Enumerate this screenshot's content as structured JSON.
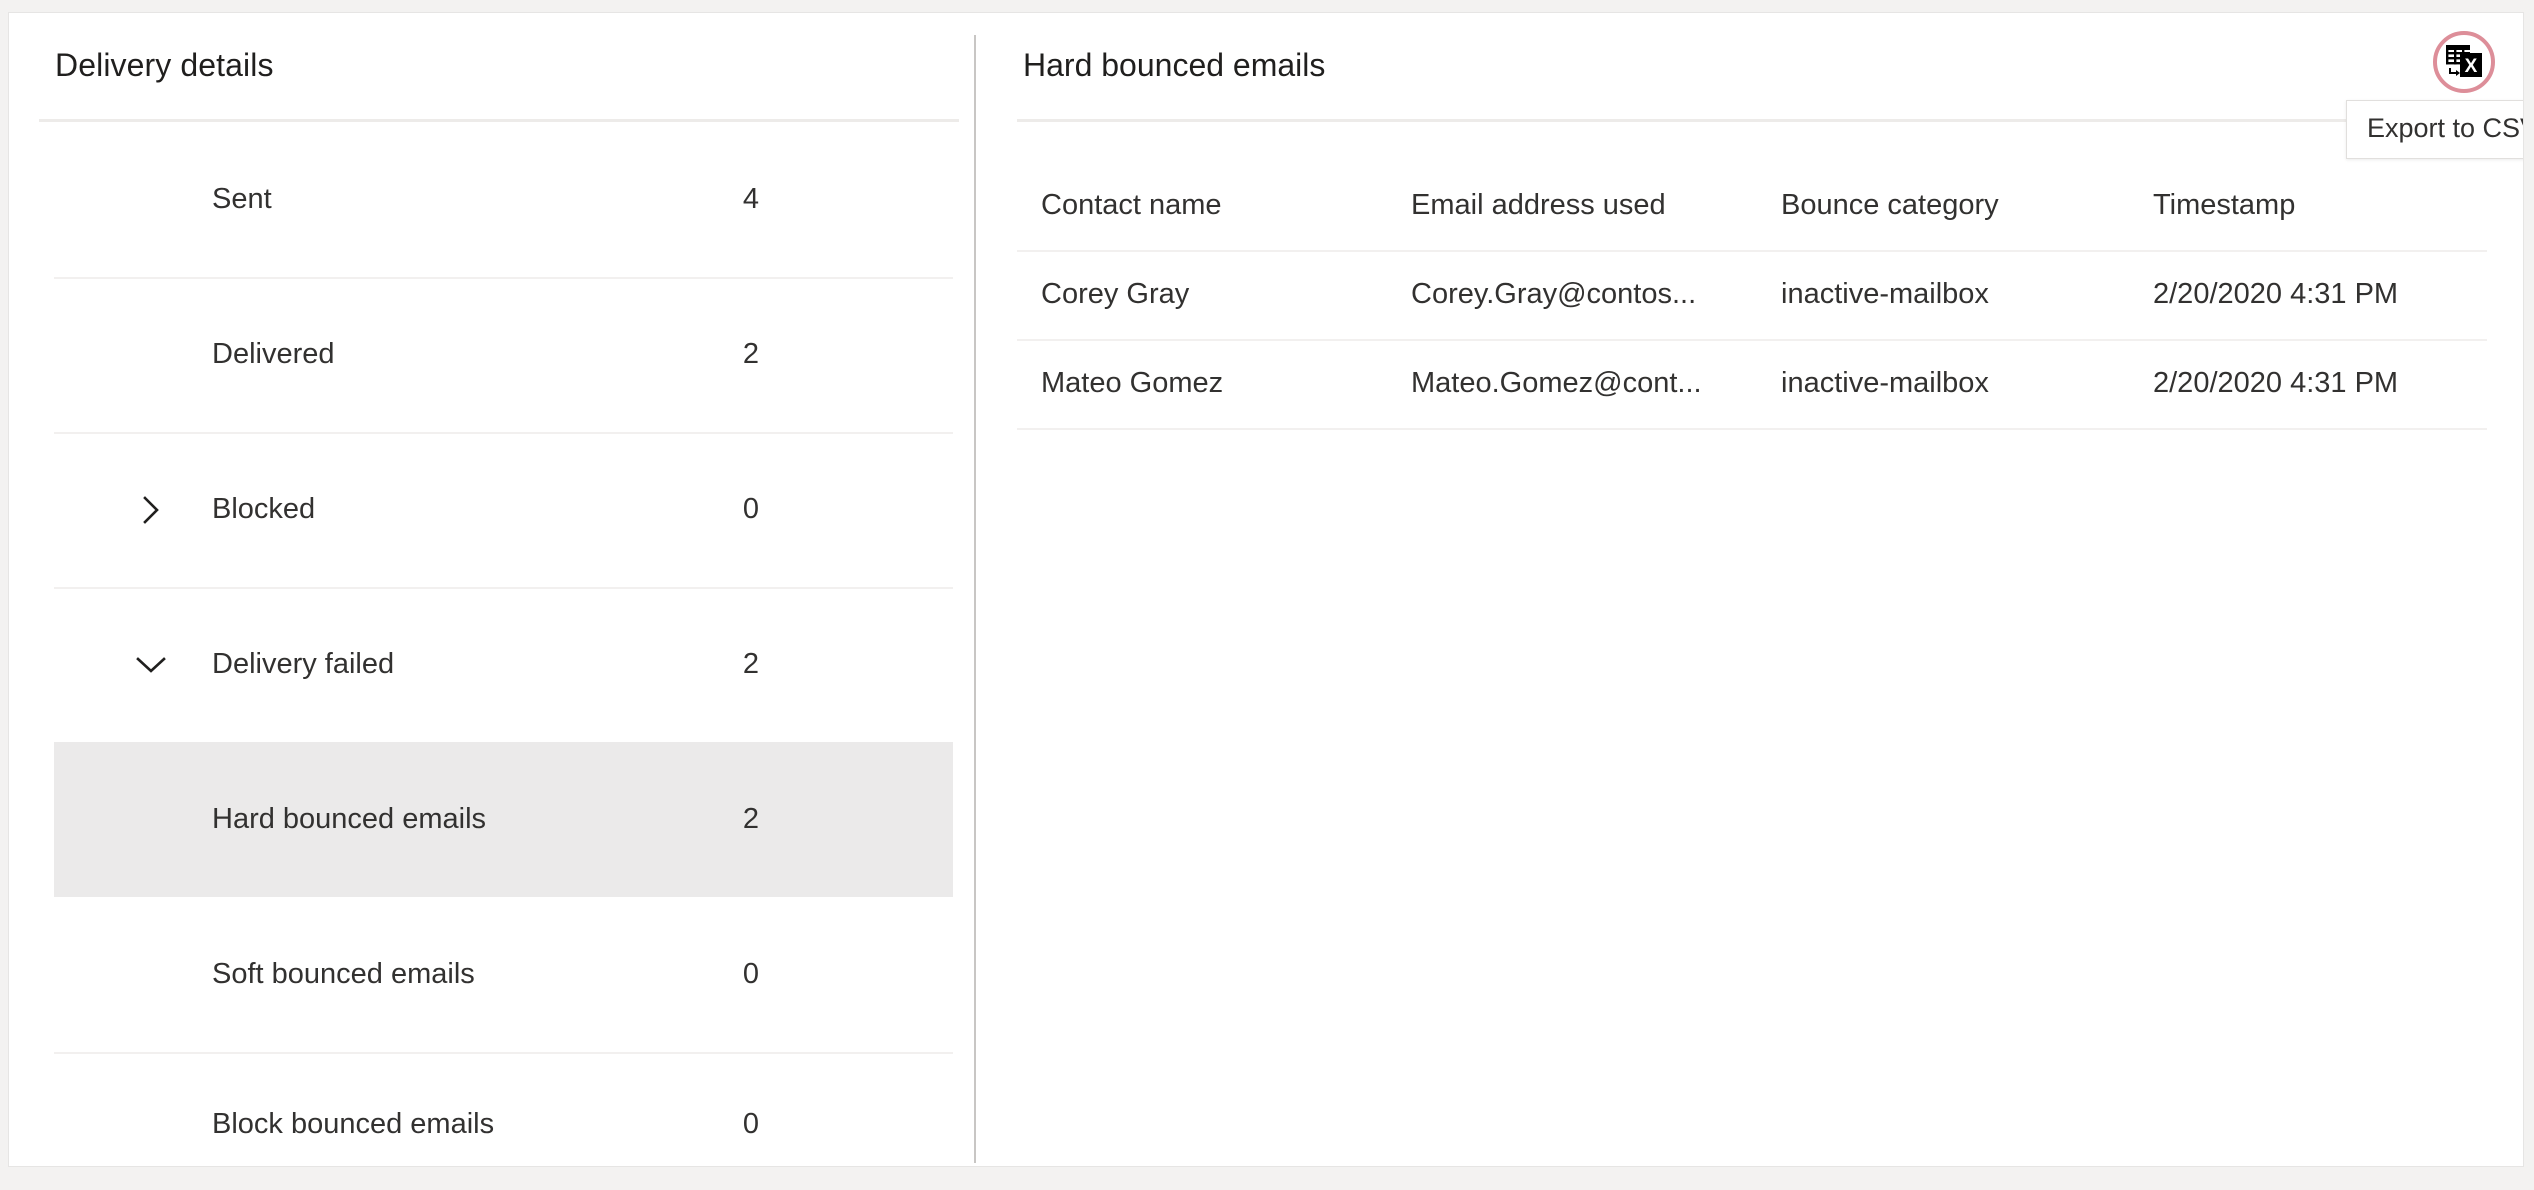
{
  "left": {
    "title": "Delivery details",
    "items": [
      {
        "label": "Sent",
        "value": "4",
        "chevron": "none",
        "selected": false,
        "indent": "normal"
      },
      {
        "label": "Delivered",
        "value": "2",
        "chevron": "none",
        "selected": false,
        "indent": "normal"
      },
      {
        "label": "Blocked",
        "value": "0",
        "chevron": "chevron-right-icon",
        "selected": false,
        "indent": "normal"
      },
      {
        "label": "Delivery failed",
        "value": "2",
        "chevron": "chevron-down-icon",
        "selected": false,
        "indent": "normal"
      },
      {
        "label": "Hard bounced emails",
        "value": "2",
        "chevron": "none",
        "selected": true,
        "indent": "child"
      },
      {
        "label": "Soft bounced emails",
        "value": "0",
        "chevron": "none",
        "selected": false,
        "indent": "child"
      },
      {
        "label": "Block bounced emails",
        "value": "0",
        "chevron": "none",
        "selected": false,
        "indent": "child"
      }
    ]
  },
  "right": {
    "title": "Hard bounced emails",
    "export": {
      "icon": "export-to-excel-icon",
      "tooltip": "Export to CSV",
      "highlight_color": "#dd8e99"
    },
    "table": {
      "columns": [
        "Contact name",
        "Email address used",
        "Bounce category",
        "Timestamp"
      ],
      "rows": [
        [
          "Corey Gray",
          "Corey.Gray@contos...",
          "inactive-mailbox",
          "2/20/2020 4:31 PM"
        ],
        [
          "Mateo Gomez",
          "Mateo.Gomez@cont...",
          "inactive-mailbox",
          "2/20/2020 4:31 PM"
        ]
      ]
    }
  },
  "colors": {
    "selected_row_bg": "#ebeaea",
    "divider": "#c8c6c4",
    "row_separator": "#f2f0ef",
    "text": "#323130",
    "heading": "#201f1e"
  }
}
